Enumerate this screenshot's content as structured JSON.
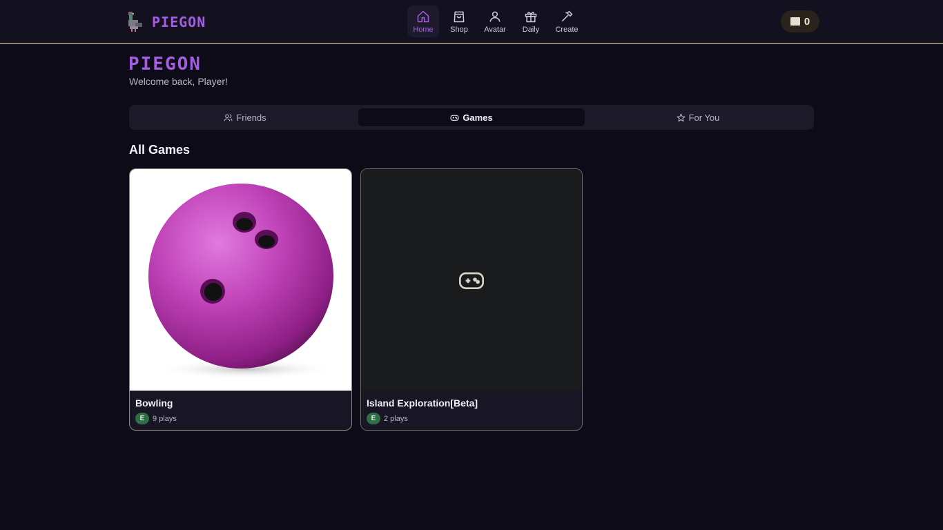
{
  "header": {
    "brand": "PIEGON",
    "logo_icon": "pigeon-logo-icon",
    "nav": [
      {
        "label": "Home",
        "icon": "home-icon",
        "active": true
      },
      {
        "label": "Shop",
        "icon": "shopping-bag-icon",
        "active": false
      },
      {
        "label": "Avatar",
        "icon": "user-icon",
        "active": false
      },
      {
        "label": "Daily",
        "icon": "gift-icon",
        "active": false
      },
      {
        "label": "Create",
        "icon": "hammer-icon",
        "active": false
      }
    ],
    "coins": "0"
  },
  "main": {
    "title": "PIEGON",
    "welcome": "Welcome back, Player!",
    "tabs": [
      {
        "label": "Friends",
        "icon": "users-icon",
        "active": false
      },
      {
        "label": "Games",
        "icon": "gamepad-icon",
        "active": true
      },
      {
        "label": "For You",
        "icon": "star-icon",
        "active": false
      }
    ],
    "section_title": "All Games",
    "games": [
      {
        "title": "Bowling",
        "rating": "E",
        "plays": "9 plays",
        "thumbnail": "bowling-ball-image"
      },
      {
        "title": "Island Exploration[Beta]",
        "rating": "E",
        "plays": "2 plays",
        "thumbnail": "gamepad-placeholder-icon"
      }
    ]
  },
  "colors": {
    "accent": "#a45ee0",
    "background": "#0e0b19",
    "rating_badge": "#2f6e44"
  }
}
